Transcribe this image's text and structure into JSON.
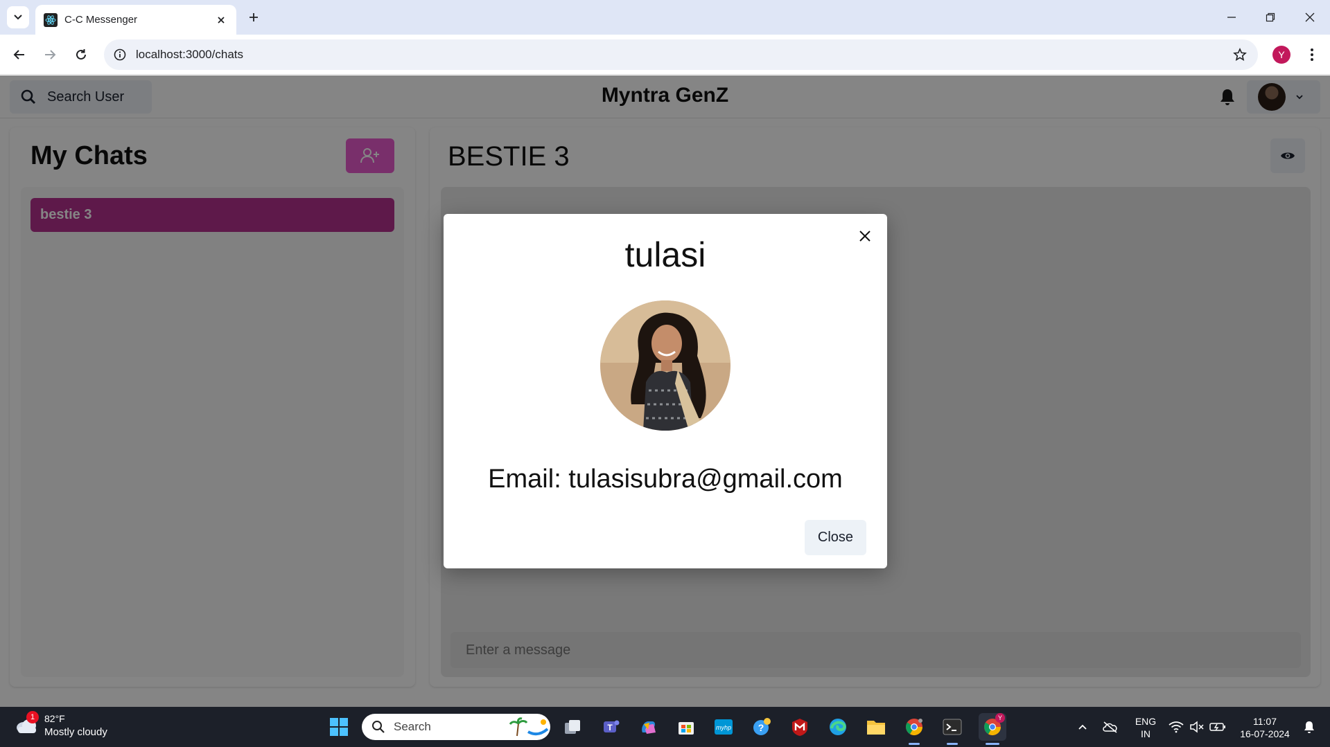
{
  "browser": {
    "tab_title": "C-C Messenger",
    "url": "localhost:3000/chats",
    "profile_initial": "Y"
  },
  "app": {
    "search_label": "Search User",
    "brand": "Myntra GenZ",
    "my_chats_title": "My Chats",
    "chats": [
      {
        "name": "bestie 3",
        "selected": true
      }
    ],
    "active_chat_title": "BESTIE 3",
    "message_placeholder": "Enter a message",
    "accent_color": "#b5318f",
    "new_group_button_color": "#e85bcd"
  },
  "modal": {
    "title": "tulasi",
    "email_text": "Email: tulasisubra@gmail.com",
    "close_label": "Close"
  },
  "taskbar": {
    "weather_badge": "1",
    "weather_temp": "82°F",
    "weather_desc": "Mostly cloudy",
    "search_label": "Search",
    "lang_line1": "ENG",
    "lang_line2": "IN",
    "time": "11:07",
    "date": "16-07-2024",
    "chrome_badge": "Y"
  }
}
